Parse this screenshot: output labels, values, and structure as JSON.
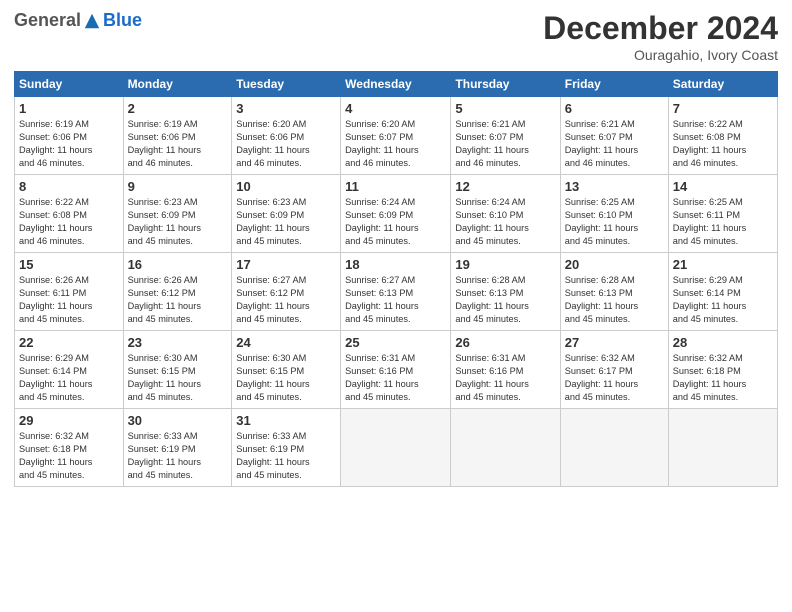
{
  "header": {
    "logo": {
      "general": "General",
      "blue": "Blue"
    },
    "month_title": "December 2024",
    "subtitle": "Ouragahio, Ivory Coast"
  },
  "weekdays": [
    "Sunday",
    "Monday",
    "Tuesday",
    "Wednesday",
    "Thursday",
    "Friday",
    "Saturday"
  ],
  "weeks": [
    [
      {
        "day": "1",
        "info": "Sunrise: 6:19 AM\nSunset: 6:06 PM\nDaylight: 11 hours\nand 46 minutes."
      },
      {
        "day": "2",
        "info": "Sunrise: 6:19 AM\nSunset: 6:06 PM\nDaylight: 11 hours\nand 46 minutes."
      },
      {
        "day": "3",
        "info": "Sunrise: 6:20 AM\nSunset: 6:06 PM\nDaylight: 11 hours\nand 46 minutes."
      },
      {
        "day": "4",
        "info": "Sunrise: 6:20 AM\nSunset: 6:07 PM\nDaylight: 11 hours\nand 46 minutes."
      },
      {
        "day": "5",
        "info": "Sunrise: 6:21 AM\nSunset: 6:07 PM\nDaylight: 11 hours\nand 46 minutes."
      },
      {
        "day": "6",
        "info": "Sunrise: 6:21 AM\nSunset: 6:07 PM\nDaylight: 11 hours\nand 46 minutes."
      },
      {
        "day": "7",
        "info": "Sunrise: 6:22 AM\nSunset: 6:08 PM\nDaylight: 11 hours\nand 46 minutes."
      }
    ],
    [
      {
        "day": "8",
        "info": "Sunrise: 6:22 AM\nSunset: 6:08 PM\nDaylight: 11 hours\nand 46 minutes."
      },
      {
        "day": "9",
        "info": "Sunrise: 6:23 AM\nSunset: 6:09 PM\nDaylight: 11 hours\nand 45 minutes."
      },
      {
        "day": "10",
        "info": "Sunrise: 6:23 AM\nSunset: 6:09 PM\nDaylight: 11 hours\nand 45 minutes."
      },
      {
        "day": "11",
        "info": "Sunrise: 6:24 AM\nSunset: 6:09 PM\nDaylight: 11 hours\nand 45 minutes."
      },
      {
        "day": "12",
        "info": "Sunrise: 6:24 AM\nSunset: 6:10 PM\nDaylight: 11 hours\nand 45 minutes."
      },
      {
        "day": "13",
        "info": "Sunrise: 6:25 AM\nSunset: 6:10 PM\nDaylight: 11 hours\nand 45 minutes."
      },
      {
        "day": "14",
        "info": "Sunrise: 6:25 AM\nSunset: 6:11 PM\nDaylight: 11 hours\nand 45 minutes."
      }
    ],
    [
      {
        "day": "15",
        "info": "Sunrise: 6:26 AM\nSunset: 6:11 PM\nDaylight: 11 hours\nand 45 minutes."
      },
      {
        "day": "16",
        "info": "Sunrise: 6:26 AM\nSunset: 6:12 PM\nDaylight: 11 hours\nand 45 minutes."
      },
      {
        "day": "17",
        "info": "Sunrise: 6:27 AM\nSunset: 6:12 PM\nDaylight: 11 hours\nand 45 minutes."
      },
      {
        "day": "18",
        "info": "Sunrise: 6:27 AM\nSunset: 6:13 PM\nDaylight: 11 hours\nand 45 minutes."
      },
      {
        "day": "19",
        "info": "Sunrise: 6:28 AM\nSunset: 6:13 PM\nDaylight: 11 hours\nand 45 minutes."
      },
      {
        "day": "20",
        "info": "Sunrise: 6:28 AM\nSunset: 6:13 PM\nDaylight: 11 hours\nand 45 minutes."
      },
      {
        "day": "21",
        "info": "Sunrise: 6:29 AM\nSunset: 6:14 PM\nDaylight: 11 hours\nand 45 minutes."
      }
    ],
    [
      {
        "day": "22",
        "info": "Sunrise: 6:29 AM\nSunset: 6:14 PM\nDaylight: 11 hours\nand 45 minutes."
      },
      {
        "day": "23",
        "info": "Sunrise: 6:30 AM\nSunset: 6:15 PM\nDaylight: 11 hours\nand 45 minutes."
      },
      {
        "day": "24",
        "info": "Sunrise: 6:30 AM\nSunset: 6:15 PM\nDaylight: 11 hours\nand 45 minutes."
      },
      {
        "day": "25",
        "info": "Sunrise: 6:31 AM\nSunset: 6:16 PM\nDaylight: 11 hours\nand 45 minutes."
      },
      {
        "day": "26",
        "info": "Sunrise: 6:31 AM\nSunset: 6:16 PM\nDaylight: 11 hours\nand 45 minutes."
      },
      {
        "day": "27",
        "info": "Sunrise: 6:32 AM\nSunset: 6:17 PM\nDaylight: 11 hours\nand 45 minutes."
      },
      {
        "day": "28",
        "info": "Sunrise: 6:32 AM\nSunset: 6:18 PM\nDaylight: 11 hours\nand 45 minutes."
      }
    ],
    [
      {
        "day": "29",
        "info": "Sunrise: 6:32 AM\nSunset: 6:18 PM\nDaylight: 11 hours\nand 45 minutes."
      },
      {
        "day": "30",
        "info": "Sunrise: 6:33 AM\nSunset: 6:19 PM\nDaylight: 11 hours\nand 45 minutes."
      },
      {
        "day": "31",
        "info": "Sunrise: 6:33 AM\nSunset: 6:19 PM\nDaylight: 11 hours\nand 45 minutes."
      },
      null,
      null,
      null,
      null
    ]
  ]
}
